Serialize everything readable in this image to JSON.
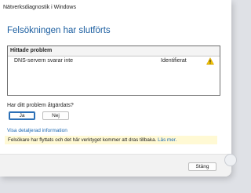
{
  "window": {
    "title": "Nätverksdiagnostik i Windows"
  },
  "main": {
    "heading": "Felsökningen har slutförts",
    "problems": {
      "header": "Hittade problem",
      "rows": [
        {
          "name": "DNS-servern svarar inte",
          "status": "Identifierat",
          "icon": "warning-icon"
        }
      ]
    },
    "question": "Har ditt problem åtgärdats?",
    "yes_label": "Ja",
    "no_label": "Nej",
    "details_link": "Visa detaljerad information",
    "info_bar": {
      "text": "Felsökare har flyttats och det här verktyget kommer att dras tillbaka.",
      "link": "Läs mer."
    }
  },
  "footer": {
    "close_label": "Stäng"
  },
  "colors": {
    "heading": "#1b5ea0",
    "link": "#1a67b2",
    "info_bar_bg": "#fff9d4",
    "warning": "#f2c200",
    "primary_border": "#2b6fb6"
  }
}
